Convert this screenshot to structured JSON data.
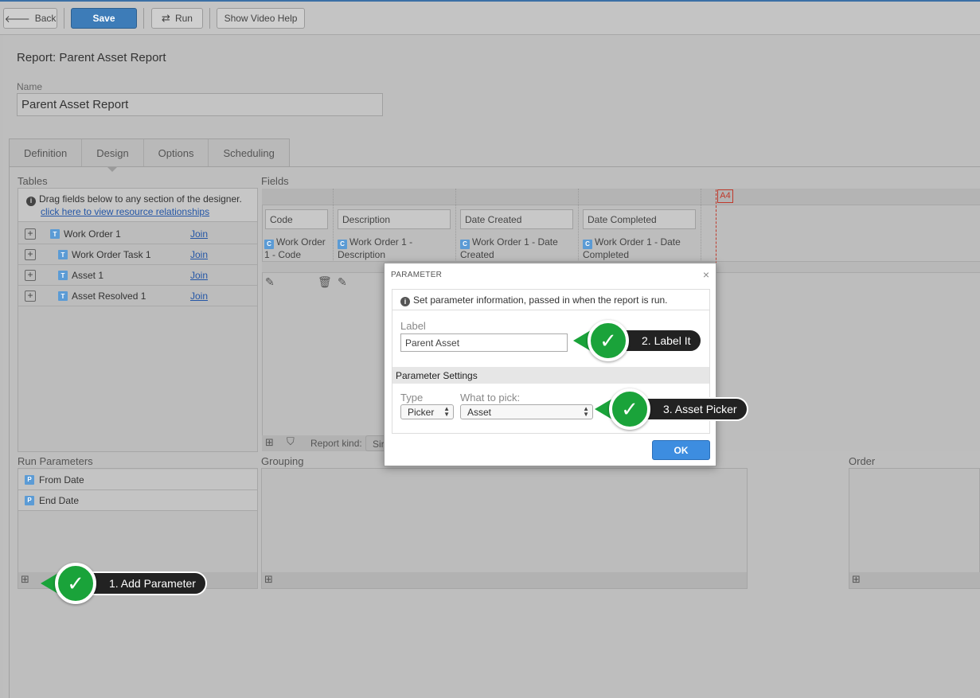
{
  "toolbar": {
    "back_label": "Back",
    "save_label": "Save",
    "run_label": "Run",
    "video_help_label": "Show Video Help"
  },
  "report": {
    "title": "Report: Parent Asset Report",
    "name_label": "Name",
    "name_value": "Parent Asset Report"
  },
  "tabs": [
    {
      "label": "Definition"
    },
    {
      "label": "Design"
    },
    {
      "label": "Options"
    },
    {
      "label": "Scheduling"
    }
  ],
  "tables": {
    "label": "Tables",
    "info_text": "Drag fields below to any section of the designer.",
    "relationships_link": "click here to view resource relationships",
    "type_letter": "T",
    "join_label": "Join",
    "items": [
      {
        "name": "Work Order 1"
      },
      {
        "name": "Work Order Task 1"
      },
      {
        "name": "Asset 1"
      },
      {
        "name": "Asset Resolved 1"
      }
    ]
  },
  "fields": {
    "label": "Fields",
    "page_size": "A4",
    "column_letter": "C",
    "report_kind_label": "Report kind:",
    "report_kind_value": "Sir",
    "columns": [
      {
        "header": "Code",
        "value": "Work Order 1 - Code"
      },
      {
        "header": "Description",
        "value": "Work Order 1 - Description"
      },
      {
        "header": "Date Created",
        "value": "Work Order 1 - Date Created"
      },
      {
        "header": "Date Completed",
        "value": "Work Order 1 - Date Completed"
      }
    ]
  },
  "run_parameters": {
    "label": "Run Parameters",
    "type_letter": "P",
    "items": [
      {
        "name": "From Date"
      },
      {
        "name": "End Date"
      }
    ]
  },
  "grouping": {
    "label": "Grouping"
  },
  "order": {
    "label": "Order"
  },
  "modal": {
    "title": "PARAMETER",
    "close": "×",
    "info_text": "Set parameter information, passed in when the report is run.",
    "label_label": "Label",
    "label_value": "Parent Asset",
    "settings_title": "Parameter Settings",
    "type_label": "Type",
    "type_value": "Picker",
    "pick_label": "What to pick:",
    "pick_value": "Asset",
    "ok_label": "OK"
  },
  "callouts": [
    {
      "text": "1. Add Parameter"
    },
    {
      "text": "2. Label It"
    },
    {
      "text": "3. Asset Picker"
    }
  ],
  "colors": {
    "save_button": "#3d7cb8",
    "ok_button": "#3d8de0",
    "callout_green": "#1aa33a",
    "link_blue": "#2456a6",
    "page_marker_red": "#c0392b"
  }
}
